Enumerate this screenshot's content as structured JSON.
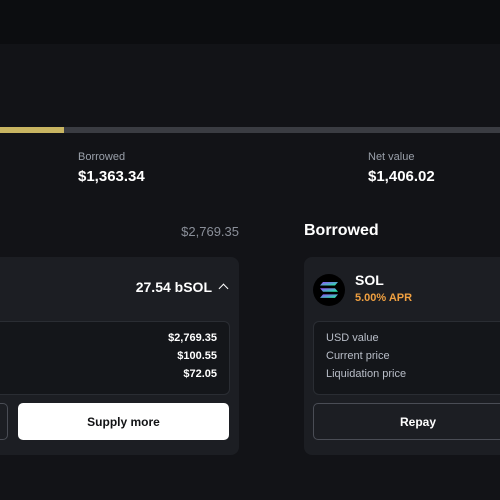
{
  "stats": {
    "borrowed_label": "Borrowed",
    "borrowed_value": "$1,363.34",
    "net_value_label": "Net value",
    "net_value_value": "$1,406.02",
    "progress_fraction": 0.128
  },
  "supplied": {
    "total": "$2,769.35",
    "amount": "27.54 bSOL",
    "details": [
      "$2,769.35",
      "$100.55",
      "$72.05"
    ],
    "supply_more_label": "Supply more"
  },
  "borrowed_section": {
    "heading": "Borrowed",
    "token": "SOL",
    "apr": "5.00% APR",
    "detail_labels": [
      "USD value",
      "Current price",
      "Liquidation price"
    ],
    "repay_label": "Repay"
  },
  "colors": {
    "accent_progress": "#c8b562",
    "apr": "#f0a040",
    "background": "#121317",
    "card": "#1c1e23"
  },
  "icons": {
    "token_icon": "solana-icon",
    "collapse_icon": "chevron-up-icon"
  }
}
